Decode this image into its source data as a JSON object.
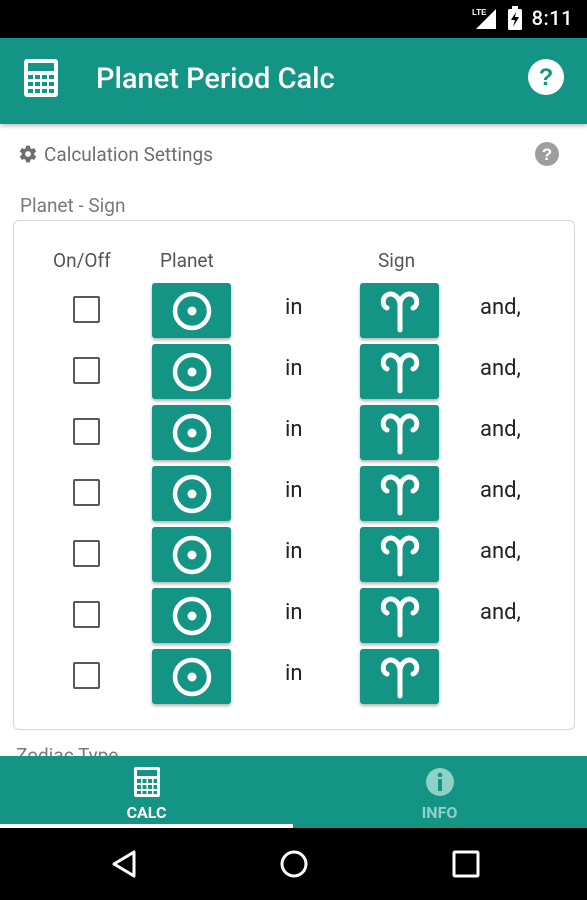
{
  "status_bar": {
    "time": "8:11",
    "network": "LTE"
  },
  "app_bar": {
    "title": "Planet Period Calc"
  },
  "settings": {
    "title": "Calculation Settings"
  },
  "section": {
    "label": "Planet - Sign"
  },
  "table": {
    "headers": {
      "on_off": "On/Off",
      "planet": "Planet",
      "sign": "Sign"
    },
    "rows": [
      {
        "checked": false,
        "planet_icon": "sun-symbol",
        "connector": "in",
        "sign_icon": "aries-symbol",
        "suffix": "and,"
      },
      {
        "checked": false,
        "planet_icon": "sun-symbol",
        "connector": "in",
        "sign_icon": "aries-symbol",
        "suffix": "and,"
      },
      {
        "checked": false,
        "planet_icon": "sun-symbol",
        "connector": "in",
        "sign_icon": "aries-symbol",
        "suffix": "and,"
      },
      {
        "checked": false,
        "planet_icon": "sun-symbol",
        "connector": "in",
        "sign_icon": "aries-symbol",
        "suffix": "and,"
      },
      {
        "checked": false,
        "planet_icon": "sun-symbol",
        "connector": "in",
        "sign_icon": "aries-symbol",
        "suffix": "and,"
      },
      {
        "checked": false,
        "planet_icon": "sun-symbol",
        "connector": "in",
        "sign_icon": "aries-symbol",
        "suffix": "and,"
      },
      {
        "checked": false,
        "planet_icon": "sun-symbol",
        "connector": "in",
        "sign_icon": "aries-symbol",
        "suffix": ""
      }
    ]
  },
  "next_section": {
    "label": "Zodiac Type"
  },
  "bottom_nav": {
    "tabs": [
      {
        "label": "CALC",
        "icon": "calculator-icon",
        "active": true
      },
      {
        "label": "INFO",
        "icon": "info-icon",
        "active": false
      }
    ]
  },
  "colors": {
    "primary": "#139484",
    "inactive_tab": "#8fd0c7",
    "label_gray": "#7a7a7a"
  }
}
